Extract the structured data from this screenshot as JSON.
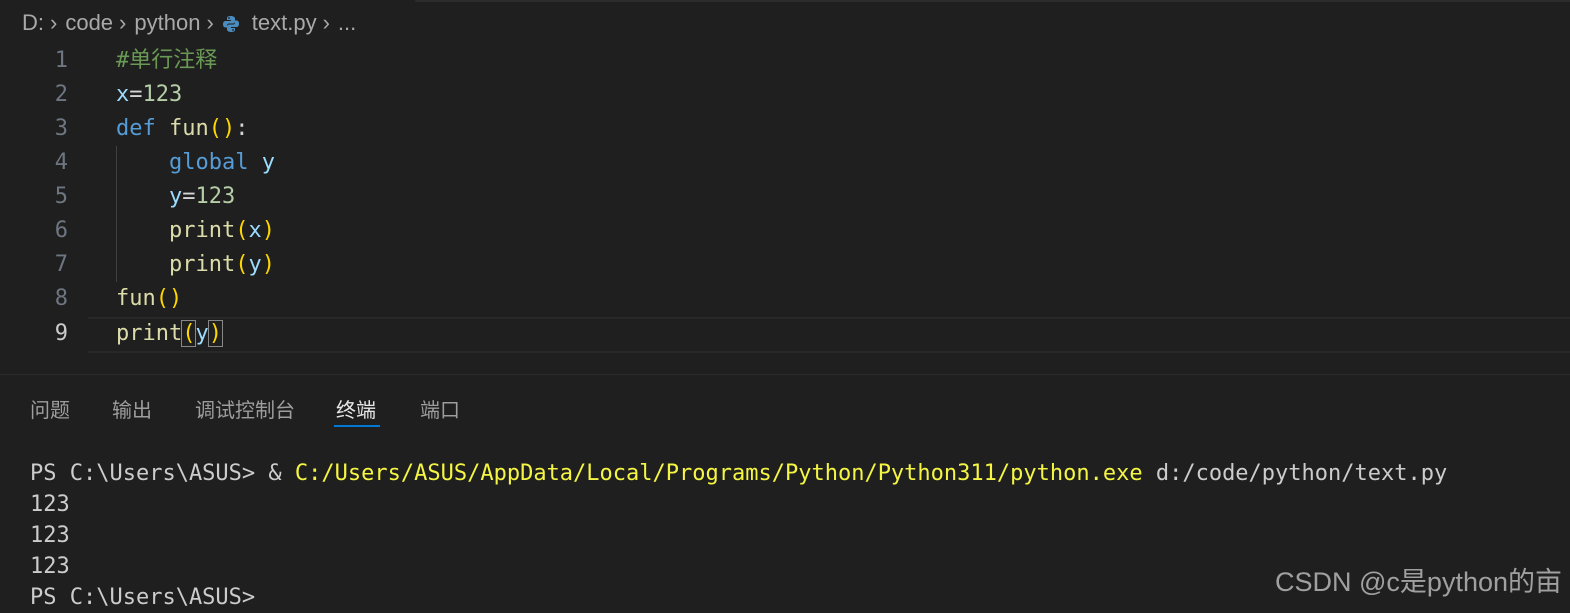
{
  "breadcrumb": {
    "items": [
      "D:",
      "code",
      "python",
      "text.py",
      "..."
    ],
    "separator": "›"
  },
  "editor": {
    "line_numbers": [
      "1",
      "2",
      "3",
      "4",
      "5",
      "6",
      "7",
      "8",
      "9"
    ],
    "lines": {
      "l1": {
        "comment": "#单行注释"
      },
      "l2": {
        "var": "x",
        "op": "=",
        "num": "123"
      },
      "l3": {
        "kw": "def",
        "fn": "fun",
        "open": "(",
        "close": ")",
        "colon": ":"
      },
      "l4": {
        "indent": "    ",
        "kw": "global",
        "var": "y"
      },
      "l5": {
        "indent": "    ",
        "var": "y",
        "op": "=",
        "num": "123"
      },
      "l6": {
        "indent": "    ",
        "fn": "print",
        "open": "(",
        "arg": "x",
        "close": ")"
      },
      "l7": {
        "indent": "    ",
        "fn": "print",
        "open": "(",
        "arg": "y",
        "close": ")"
      },
      "l8": {
        "fn": "fun",
        "open": "(",
        "close": ")"
      },
      "l9": {
        "fn": "print",
        "open": "(",
        "arg": "y",
        "close": ")"
      }
    }
  },
  "panel": {
    "tabs": [
      "问题",
      "输出",
      "调试控制台",
      "终端",
      "端口"
    ],
    "active_tab": "终端"
  },
  "terminal": {
    "prompt1": "PS C:\\Users\\ASUS> & ",
    "exe_path": "C:/Users/ASUS/AppData/Local/Programs/Python/Python311/python.exe",
    "script_arg": " d:/code/python/text.py",
    "output": [
      "123",
      "123",
      "123"
    ],
    "prompt2": "PS C:\\Users\\ASUS>"
  },
  "watermark": "CSDN @c是python的亩",
  "colors": {
    "background": "#1f1f1f",
    "comment": "#6a9955",
    "keyword": "#569cd6",
    "function": "#dcdcaa",
    "variable": "#9cdcfe",
    "number": "#b5cea8",
    "bracket": "#ffd700",
    "terminal_path": "#f5f543",
    "tab_underline": "#0078d4"
  },
  "icons": {
    "file": "python-file-icon",
    "chevron": "chevron-right-icon"
  }
}
